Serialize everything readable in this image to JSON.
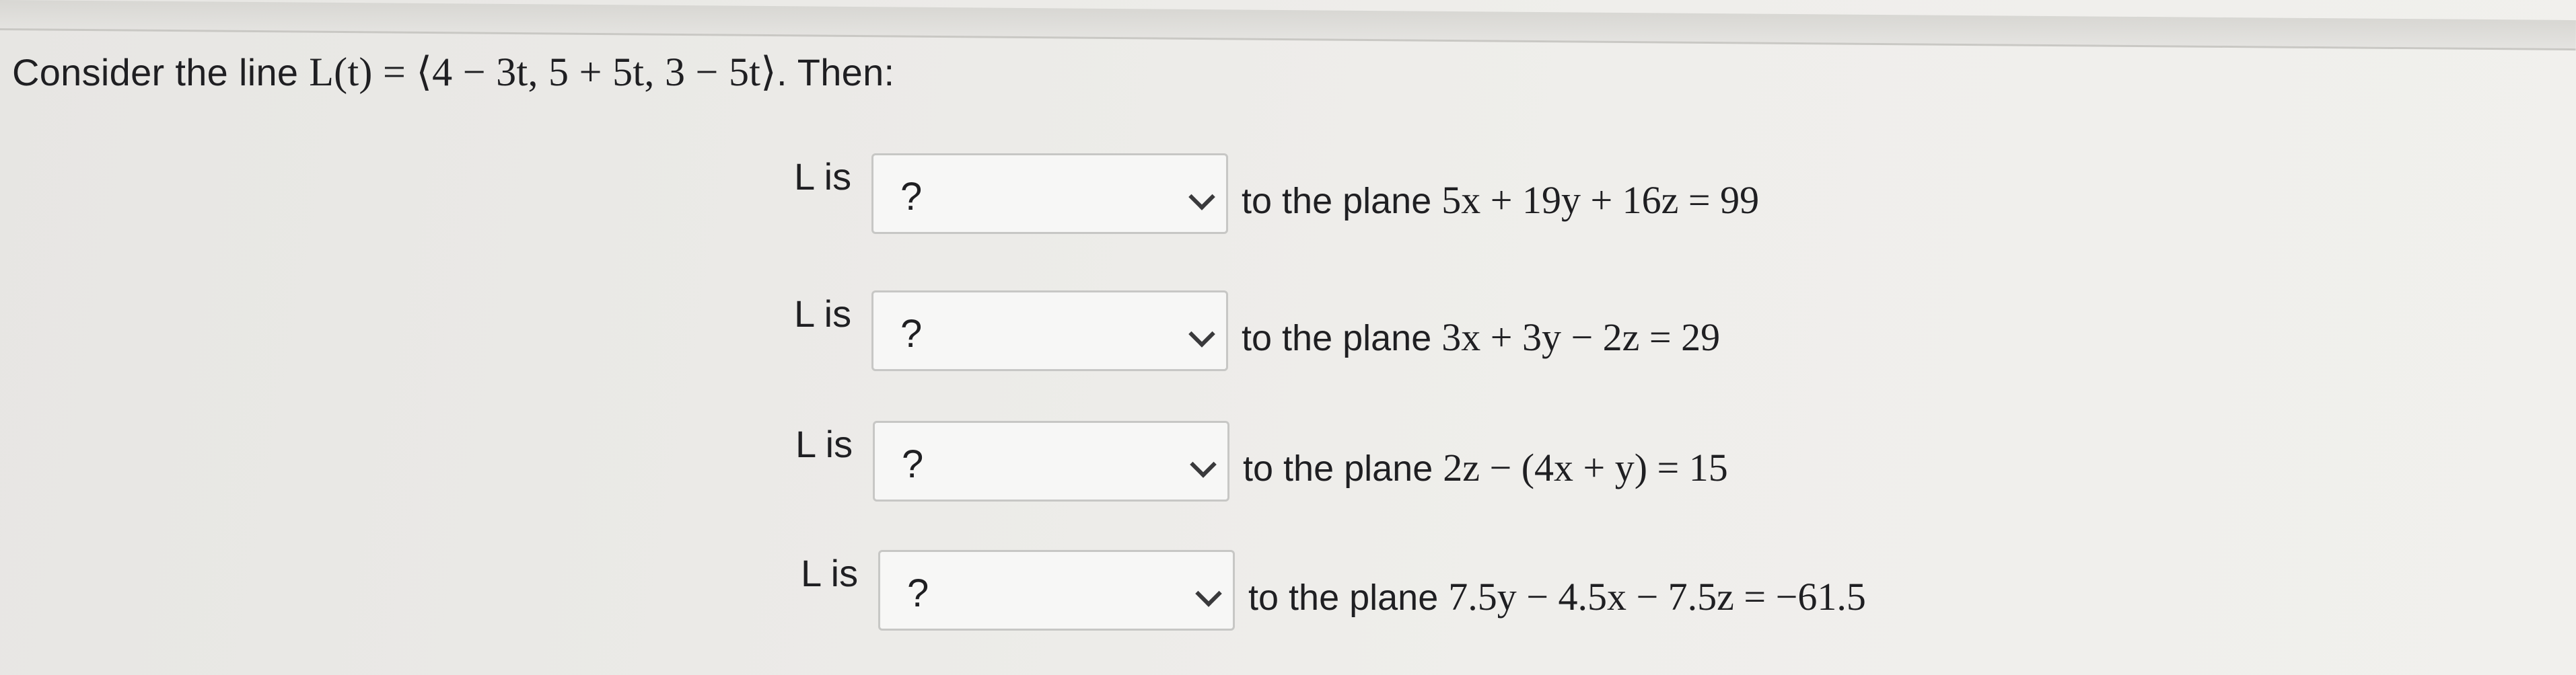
{
  "question": {
    "prefix": "Consider the line",
    "line_expression": "L(t) = ⟨4 − 3t, 5 + 5t, 3 − 5t⟩",
    "suffix": ". Then:"
  },
  "rows": [
    {
      "label": "L is",
      "selected": "?",
      "text": "to the plane",
      "plane": "5x + 19y + 16z = 99"
    },
    {
      "label": "L is",
      "selected": "?",
      "text": "to the plane",
      "plane": "3x + 3y − 2z = 29"
    },
    {
      "label": "L is",
      "selected": "?",
      "text": "to the plane",
      "plane": "2z − (4x + y) = 15"
    },
    {
      "label": "L is",
      "selected": "?",
      "text": "to the plane",
      "plane": "7.5y − 4.5x − 7.5z = −61.5"
    }
  ]
}
